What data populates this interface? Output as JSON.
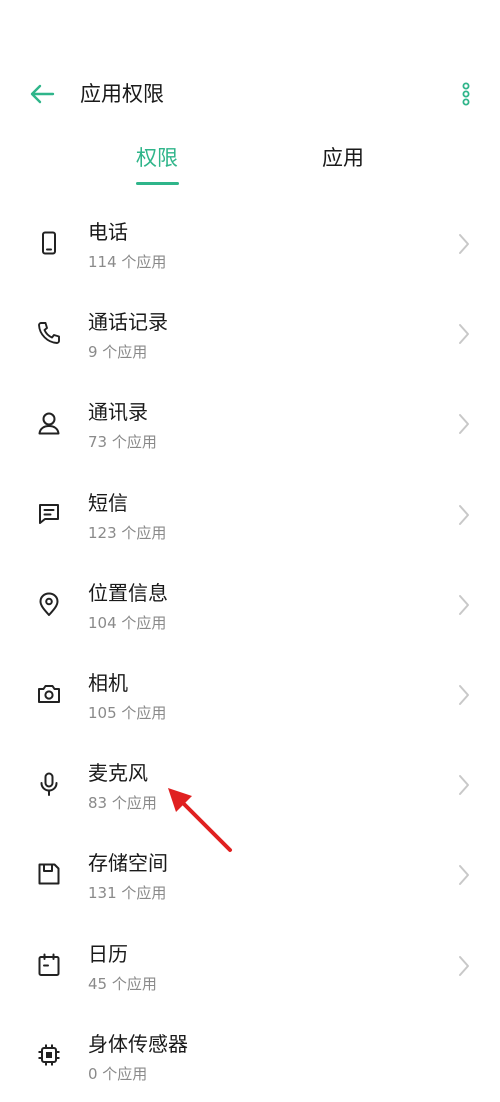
{
  "header": {
    "title": "应用权限"
  },
  "tabs": [
    {
      "label": "权限",
      "active": true
    },
    {
      "label": "应用",
      "active": false
    }
  ],
  "colors": {
    "accent": "#2fb58a",
    "annotation": "#e02020"
  },
  "permissions": [
    {
      "title": "电话",
      "count": "114 个应用",
      "icon": "phone-icon"
    },
    {
      "title": "通话记录",
      "count": "9 个应用",
      "icon": "call-log-icon"
    },
    {
      "title": "通讯录",
      "count": "73 个应用",
      "icon": "contacts-icon"
    },
    {
      "title": "短信",
      "count": "123 个应用",
      "icon": "sms-icon"
    },
    {
      "title": "位置信息",
      "count": "104 个应用",
      "icon": "location-icon"
    },
    {
      "title": "相机",
      "count": "105 个应用",
      "icon": "camera-icon"
    },
    {
      "title": "麦克风",
      "count": "83 个应用",
      "icon": "microphone-icon"
    },
    {
      "title": "存储空间",
      "count": "131 个应用",
      "icon": "storage-icon"
    },
    {
      "title": "日历",
      "count": "45 个应用",
      "icon": "calendar-icon"
    },
    {
      "title": "身体传感器",
      "count": "0 个应用",
      "icon": "body-sensor-icon"
    }
  ]
}
